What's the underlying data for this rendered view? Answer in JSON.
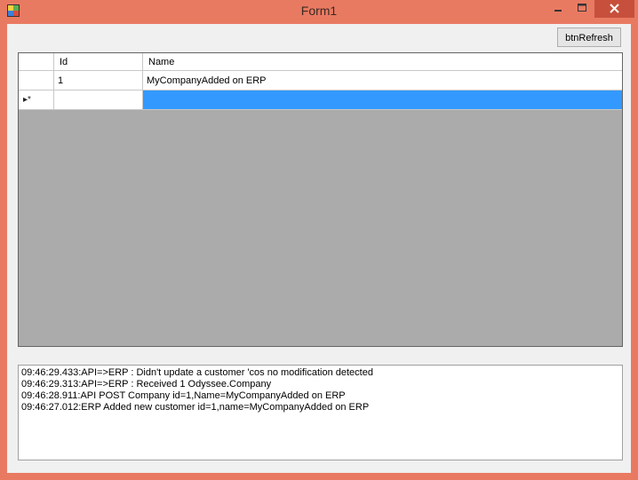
{
  "window": {
    "title": "Form1",
    "controls": {
      "minimize_icon": "minimize-icon",
      "maximize_icon": "maximize-icon",
      "close_icon": "close-icon"
    },
    "accent_color": "#e97a62"
  },
  "toolbar": {
    "refresh_label": "btnRefresh"
  },
  "grid": {
    "columns": [
      "Id",
      "Name"
    ],
    "rows": [
      {
        "id": "1",
        "name": "MyCompanyAdded on ERP"
      }
    ],
    "new_row_marker": "▸*",
    "selection_color": "#3399ff"
  },
  "log": {
    "lines": [
      "09:46:29.433:API=>ERP : Didn't update a customer 'cos no modification detected",
      "09:46:29.313:API=>ERP : Received 1 Odyssee.Company",
      "09:46:28.911:API POST Company id=1,Name=MyCompanyAdded on ERP",
      "09:46:27.012:ERP Added new customer id=1,name=MyCompanyAdded on ERP"
    ]
  }
}
